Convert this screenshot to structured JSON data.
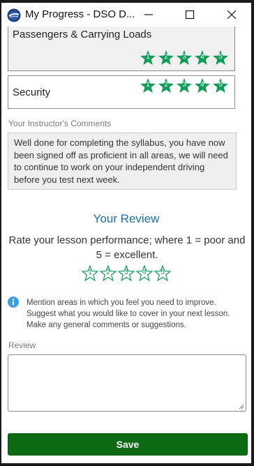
{
  "window": {
    "title": "My Progress - DSO D..."
  },
  "skills": [
    {
      "label": "Passengers & Carrying Loads",
      "stars": [
        "1",
        "2",
        "3",
        "4",
        "5"
      ]
    },
    {
      "label": "Security",
      "stars": [
        "1",
        "2",
        "3",
        "4",
        "5"
      ]
    }
  ],
  "comments": {
    "label": "Your Instructor's Comments",
    "text": "Well done for completing the syllabus, you have now been signed off as proficient in all areas, we will need to continue to work on your independent driving before you test next week."
  },
  "review": {
    "title": "Your Review",
    "description": "Rate your lesson performance; where 1 = poor and 5 = excellent.",
    "stars": [
      "1",
      "2",
      "3",
      "4",
      "5"
    ],
    "info": "Mention areas in which you feel you need to improve. Suggest what you would like to cover in your next lesson. Make any general comments or suggestions.",
    "field_label": "Review",
    "field_value": ""
  },
  "actions": {
    "save_label": "Save"
  },
  "colors": {
    "star_fill": "#0f9d58",
    "accent": "#1a6fb0",
    "save_button": "#0b6a12"
  }
}
